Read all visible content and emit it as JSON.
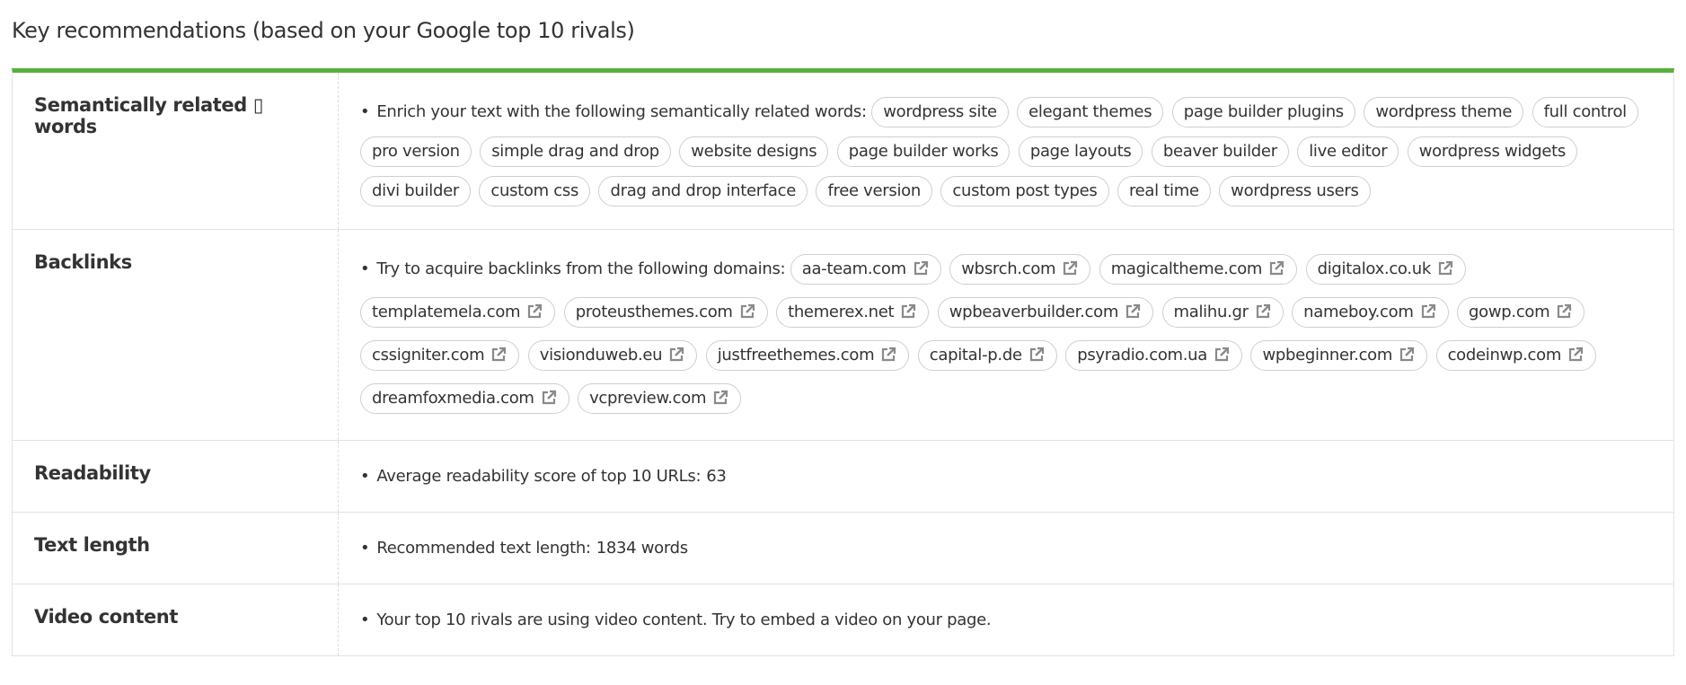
{
  "title": "Key recommendations (based on your Google top 10 rivals)",
  "rows": {
    "semantic": {
      "label": "Semantically related ▯ words",
      "text": "Enrich your text with the following semantically related words:",
      "words": [
        "wordpress site",
        "elegant themes",
        "page builder plugins",
        "wordpress theme",
        "full control",
        "pro version",
        "simple drag and drop",
        "website designs",
        "page builder works",
        "page layouts",
        "beaver builder",
        "live editor",
        "wordpress widgets",
        "divi builder",
        "custom css",
        "drag and drop interface",
        "free version",
        "custom post types",
        "real time",
        "wordpress users"
      ]
    },
    "backlinks": {
      "label": "Backlinks",
      "text": "Try to acquire backlinks from the following domains:",
      "link_icon": "external-link-icon",
      "domains": [
        "aa-team.com",
        "wbsrch.com",
        "magicaltheme.com",
        "digitalox.co.uk",
        "templatemela.com",
        "proteusthemes.com",
        "themerex.net",
        "wpbeaverbuilder.com",
        "malihu.gr",
        "nameboy.com",
        "gowp.com",
        "cssigniter.com",
        "visionduweb.eu",
        "justfreethemes.com",
        "capital-p.de",
        "psyradio.com.ua",
        "wpbeginner.com",
        "codeinwp.com",
        "dreamfoxmedia.com",
        "vcpreview.com"
      ]
    },
    "readability": {
      "label": "Readability",
      "text": "Average readability score of top 10 URLs:",
      "value": "63"
    },
    "text_length": {
      "label": "Text length",
      "text": "Recommended text length:",
      "value": "1834 words"
    },
    "video": {
      "label": "Video content",
      "text": "Your top 10 rivals are using video content. Try to embed a video on your page."
    }
  },
  "bullet": "•",
  "colors": {
    "accent": "#57b03c",
    "border": "#e2e2e2",
    "pill_border": "#cfcfcf",
    "icon": "#8a8a8a"
  }
}
